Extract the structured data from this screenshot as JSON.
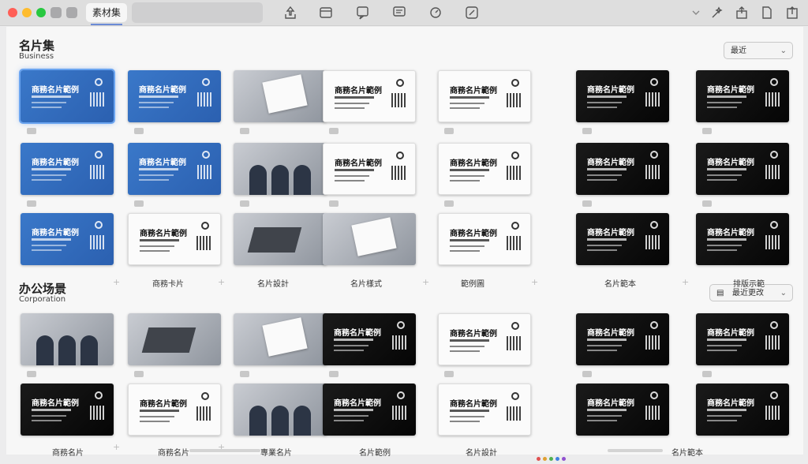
{
  "window": {
    "active_tab": "素材集",
    "traffic_colors": [
      "#ff5f57",
      "#febc2e",
      "#28c840"
    ]
  },
  "toolbar": {
    "icons": [
      "share-icon",
      "image-icon",
      "speech-icon",
      "chat-icon",
      "refresh-icon",
      "edit-icon",
      "chevron-down-icon",
      "wand-icon",
      "export-icon",
      "document-icon",
      "upload-icon"
    ]
  },
  "section1": {
    "title": "名片集",
    "subtitle": "Business",
    "dropdown": "最近"
  },
  "section2": {
    "title": "办公场景",
    "subtitle": "Corporation",
    "dropdown": "最近更改"
  },
  "card_title": "商務名片範例",
  "column_labels_mid": [
    "商務卡片",
    "名片設計",
    "名片樣式",
    "範例圖",
    "名片範本",
    "排版示範"
  ],
  "column_labels_bottom": [
    "商務名片",
    "商務名片",
    "專業名片",
    "名片範例",
    "名片設計",
    "名片範本"
  ]
}
